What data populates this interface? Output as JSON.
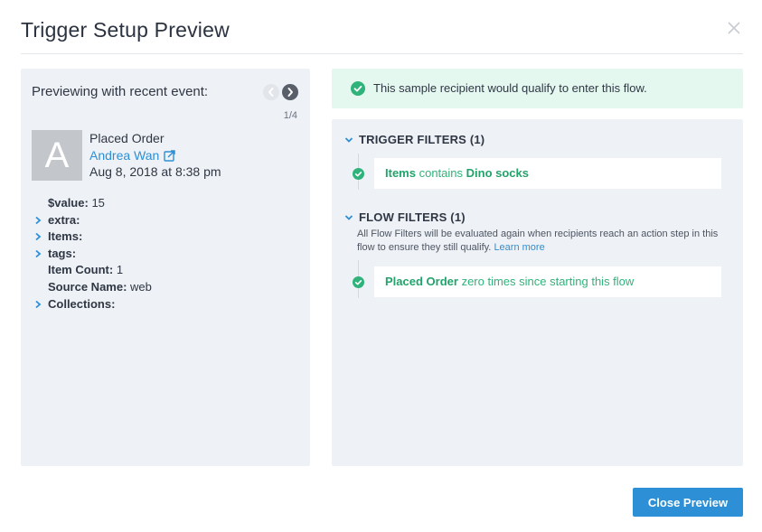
{
  "modal": {
    "title": "Trigger Setup Preview",
    "close_button_label": "Close Preview"
  },
  "event_preview": {
    "label": "Previewing with recent event:",
    "pager": "1/4",
    "avatar_initial": "A",
    "event_name": "Placed Order",
    "person_name": "Andrea Wan",
    "date": "Aug 8, 2018 at 8:38 pm",
    "properties": [
      {
        "key": "$value:",
        "value": "15",
        "expandable": false
      },
      {
        "key": "extra:",
        "value": "",
        "expandable": true
      },
      {
        "key": "Items:",
        "value": "",
        "expandable": true
      },
      {
        "key": "tags:",
        "value": "",
        "expandable": true
      },
      {
        "key": "Item Count:",
        "value": "1",
        "expandable": false
      },
      {
        "key": "Source Name:",
        "value": "web",
        "expandable": false
      },
      {
        "key": "Collections:",
        "value": "",
        "expandable": true
      }
    ]
  },
  "result": {
    "message": "This sample recipient would qualify to enter this flow."
  },
  "trigger_filters": {
    "heading": "TRIGGER FILTERS (1)",
    "filter": {
      "field": "Items",
      "operator": "contains",
      "value": "Dino socks"
    }
  },
  "flow_filters": {
    "heading": "FLOW FILTERS (1)",
    "description": "All Flow Filters will be evaluated again when recipients reach an action step in this flow to ensure they still qualify.",
    "learn_more": "Learn more",
    "filter": {
      "event": "Placed Order",
      "condition": "zero times since starting this flow"
    }
  },
  "colors": {
    "accent": "#2d8fd5",
    "success": "#2fb37a",
    "panel_bg": "#eef1f5",
    "banner_bg": "#e4f8f0"
  },
  "icons": {
    "close": "close-icon",
    "prev": "chevron-left-icon",
    "next": "chevron-right-icon",
    "external_link": "external-link-icon",
    "expand": "chevron-right-icon",
    "collapse": "chevron-down-icon",
    "check": "check-circle-icon"
  }
}
